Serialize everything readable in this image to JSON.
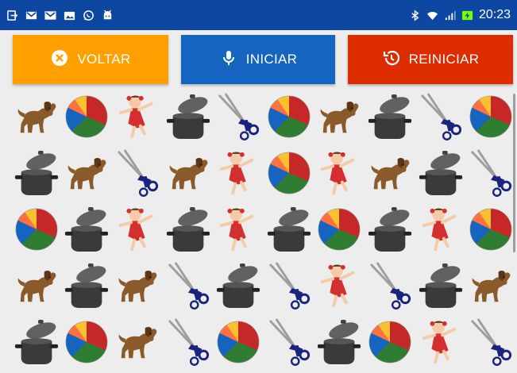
{
  "status_bar": {
    "time": "20:23",
    "left_icons": [
      "screen-cast-icon",
      "gmail-icon",
      "gmail-icon",
      "gallery-icon",
      "whatsapp-icon",
      "android-icon"
    ],
    "right_icons": [
      "bluetooth-icon",
      "wifi-icon",
      "signal-icon",
      "battery-charging-icon"
    ]
  },
  "buttons": {
    "voltar": {
      "label": "VOLTAR",
      "color": "#ff9f00",
      "icon": "close-circle-icon"
    },
    "iniciar": {
      "label": "INICIAR",
      "color": "#1565c0",
      "icon": "microphone-icon"
    },
    "reiniciar": {
      "label": "REINICIAR",
      "color": "#dd2c00",
      "icon": "restore-icon"
    }
  },
  "grid": {
    "columns": 10,
    "rows": [
      [
        "dog",
        "ball",
        "doll",
        "pot",
        "scissors",
        "ball",
        "dog",
        "pot",
        "scissors",
        "ball"
      ],
      [
        "pot",
        "dog",
        "scissors",
        "dog",
        "doll",
        "ball",
        "doll",
        "dog",
        "pot",
        "scissors"
      ],
      [
        "ball",
        "pot",
        "doll",
        "pot",
        "doll",
        "pot",
        "ball",
        "pot",
        "doll",
        "ball"
      ],
      [
        "dog",
        "pot",
        "dog",
        "scissors",
        "pot",
        "scissors",
        "doll",
        "scissors",
        "pot",
        "dog"
      ],
      [
        "pot",
        "ball",
        "dog",
        "scissors",
        "ball",
        "scissors",
        "pot",
        "ball",
        "doll",
        "scissors"
      ]
    ]
  }
}
